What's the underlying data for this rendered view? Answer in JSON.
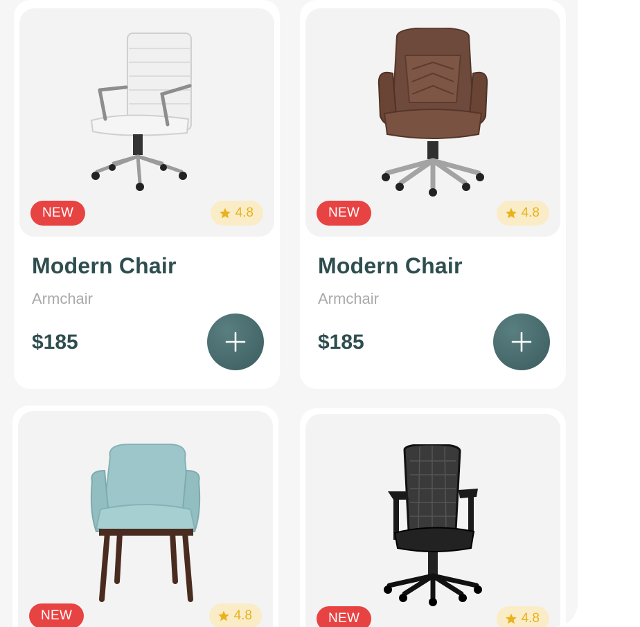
{
  "products": [
    {
      "badge": "NEW",
      "rating": "4.8",
      "name": "Modern Chair",
      "category": "Armchair",
      "price": "$185",
      "image": "white-office-chair"
    },
    {
      "badge": "NEW",
      "rating": "4.8",
      "name": "Modern Chair",
      "category": "Armchair",
      "price": "$185",
      "image": "brown-leather-office-chair"
    },
    {
      "badge": "NEW",
      "rating": "4.8",
      "image": "teal-armchair"
    },
    {
      "badge": "NEW",
      "rating": "4.8",
      "image": "black-mesh-office-chair"
    }
  ],
  "icons": {
    "star": "star-icon",
    "add": "plus-icon"
  },
  "colors": {
    "badge": "#e84343",
    "rating_bg": "#f9ecc7",
    "rating_text": "#e9b21c",
    "title": "#2e4d4f",
    "button": "#4a6f71"
  }
}
